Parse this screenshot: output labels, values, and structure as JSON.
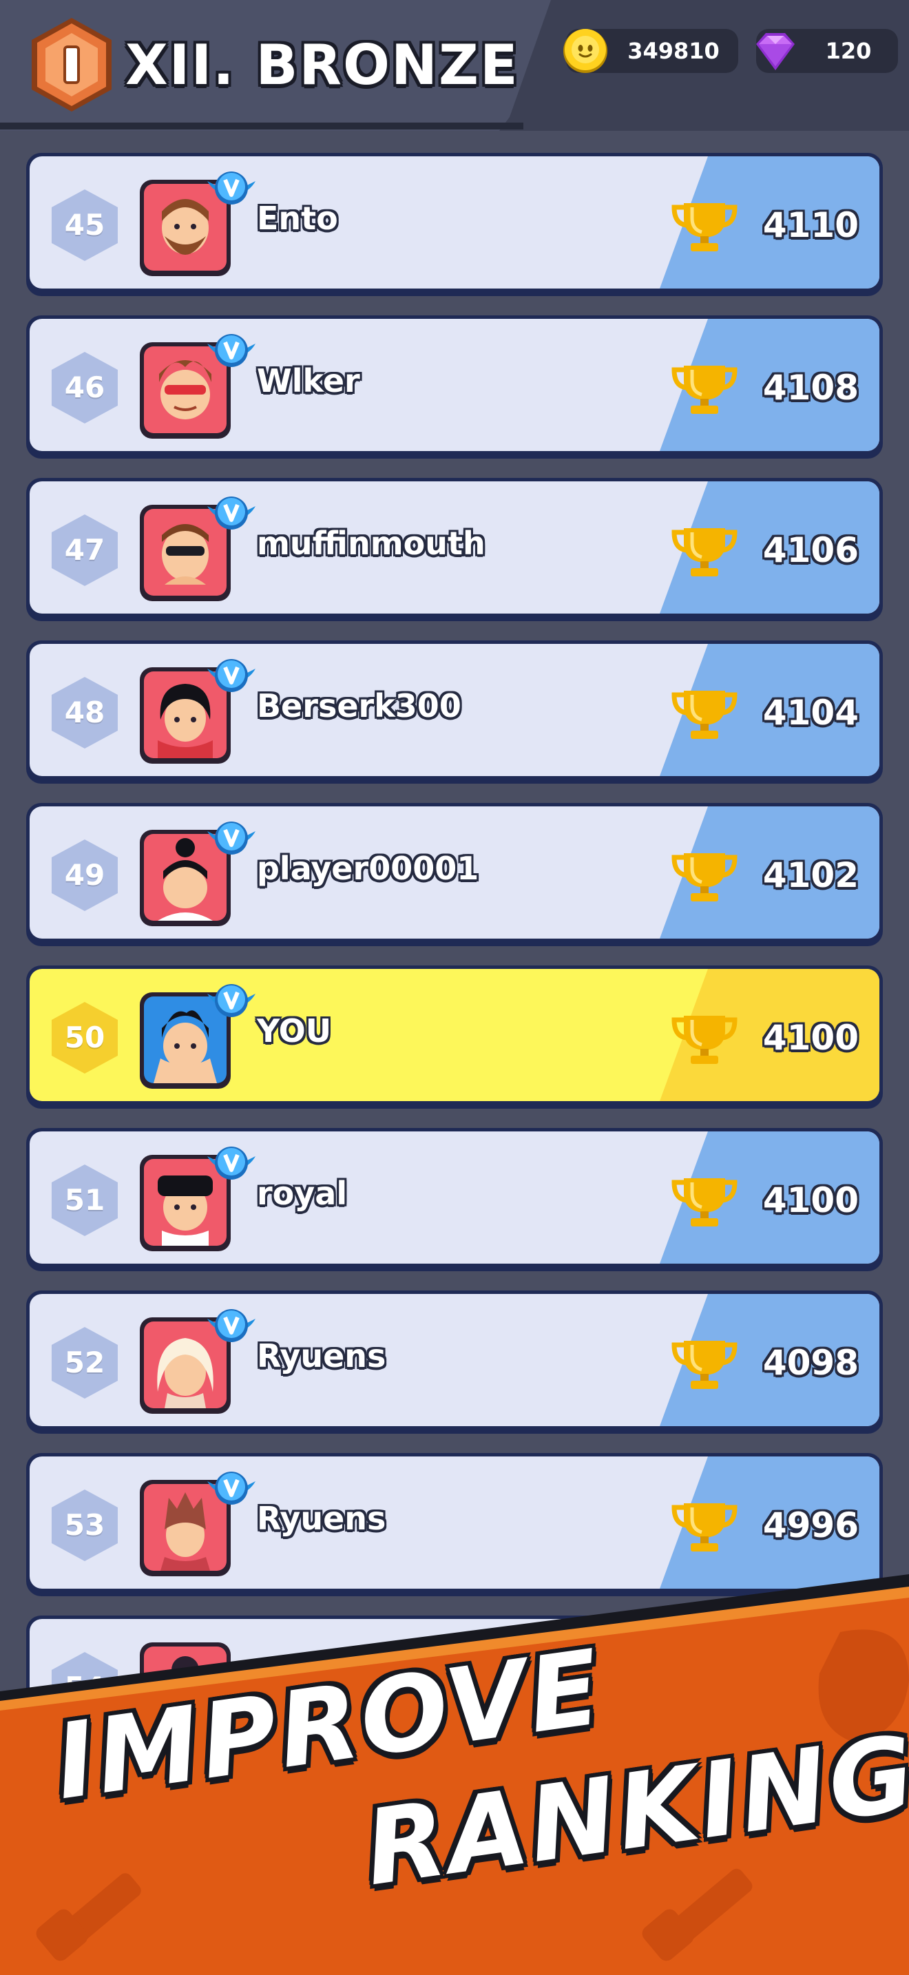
{
  "header": {
    "league_badge_icon": "bronze-shield-icon",
    "league_title": "XII. BRONZE",
    "coins": {
      "icon": "coin-icon",
      "value": "349810"
    },
    "gems": {
      "icon": "gem-icon",
      "value": "120"
    }
  },
  "leaderboard": {
    "rows": [
      {
        "rank": "45",
        "name": "Ento",
        "trophies": "4110",
        "is_me": false
      },
      {
        "rank": "46",
        "name": "Wlker",
        "trophies": "4108",
        "is_me": false
      },
      {
        "rank": "47",
        "name": "muffinmouth",
        "trophies": "4106",
        "is_me": false
      },
      {
        "rank": "48",
        "name": "Berserk300",
        "trophies": "4104",
        "is_me": false
      },
      {
        "rank": "49",
        "name": "player00001",
        "trophies": "4102",
        "is_me": false
      },
      {
        "rank": "50",
        "name": "YOU",
        "trophies": "4100",
        "is_me": true
      },
      {
        "rank": "51",
        "name": "royal",
        "trophies": "4100",
        "is_me": false
      },
      {
        "rank": "52",
        "name": "Ryuens",
        "trophies": "4098",
        "is_me": false
      },
      {
        "rank": "53",
        "name": "Ryuens",
        "trophies": "4996",
        "is_me": false
      },
      {
        "rank": "54",
        "name": "",
        "trophies": "",
        "is_me": false
      }
    ]
  },
  "banner": {
    "line1": "IMPROVE",
    "line2": "RANKING"
  },
  "colors": {
    "background": "#4a4e62",
    "row_base": "#e2e6f6",
    "row_accent": "#7fb1ec",
    "me_base": "#fdf75a",
    "me_accent": "#fbd93b",
    "banner_orange": "#e05a14",
    "trophy_gold": "#f5b400"
  }
}
